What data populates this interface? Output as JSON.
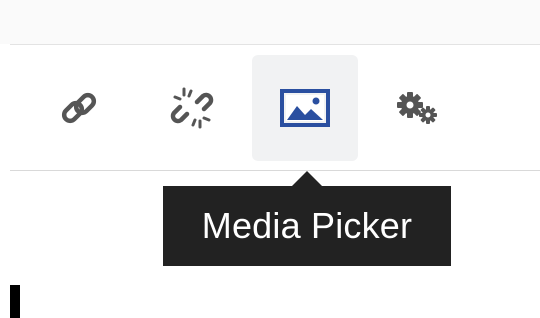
{
  "toolbar": {
    "buttons": [
      {
        "icon": "link-icon",
        "active": false
      },
      {
        "icon": "unlink-icon",
        "active": false
      },
      {
        "icon": "image-icon",
        "active": true
      },
      {
        "icon": "gears-icon",
        "active": false
      }
    ]
  },
  "tooltip": {
    "text": "Media Picker"
  },
  "colors": {
    "icon_gray": "#555555",
    "accent_blue": "#2a4fa0",
    "tooltip_bg": "#222222"
  }
}
